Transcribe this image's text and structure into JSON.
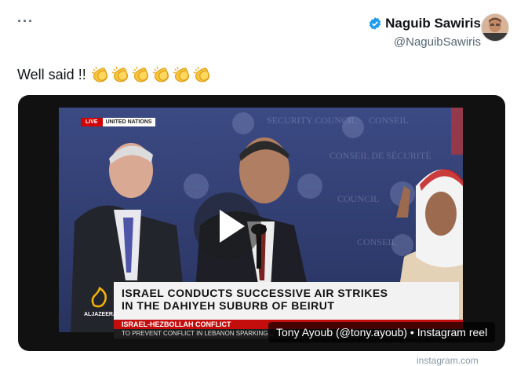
{
  "menu": {
    "more_glyph": "···"
  },
  "author": {
    "name": "Naguib Sawiris",
    "handle": "@NaguibSawiris",
    "verified_color": "#1d9bf0"
  },
  "tweet": {
    "text": "Well said !!",
    "emoji_name": "clapping-hands",
    "emoji_count": 6
  },
  "media": {
    "caption": "Tony Ayoub (@tony.ayoub) • Instagram reel",
    "source_url": "instagram.com",
    "broadcast": {
      "live_label": "LIVE",
      "location_label": "UNITED NATIONS",
      "headline_line1": "ISRAEL CONDUCTS SUCCESSIVE AIR STRIKES",
      "headline_line2": "IN THE DAHIYEH SUBURB OF BEIRUT",
      "sub_label": "ISRAEL-HEZBOLLAH CONFLICT",
      "ticker": "TO PREVENT CONFLICT IN LEBANON SPARKING...",
      "channel_name": "ALJAZEERA"
    }
  }
}
